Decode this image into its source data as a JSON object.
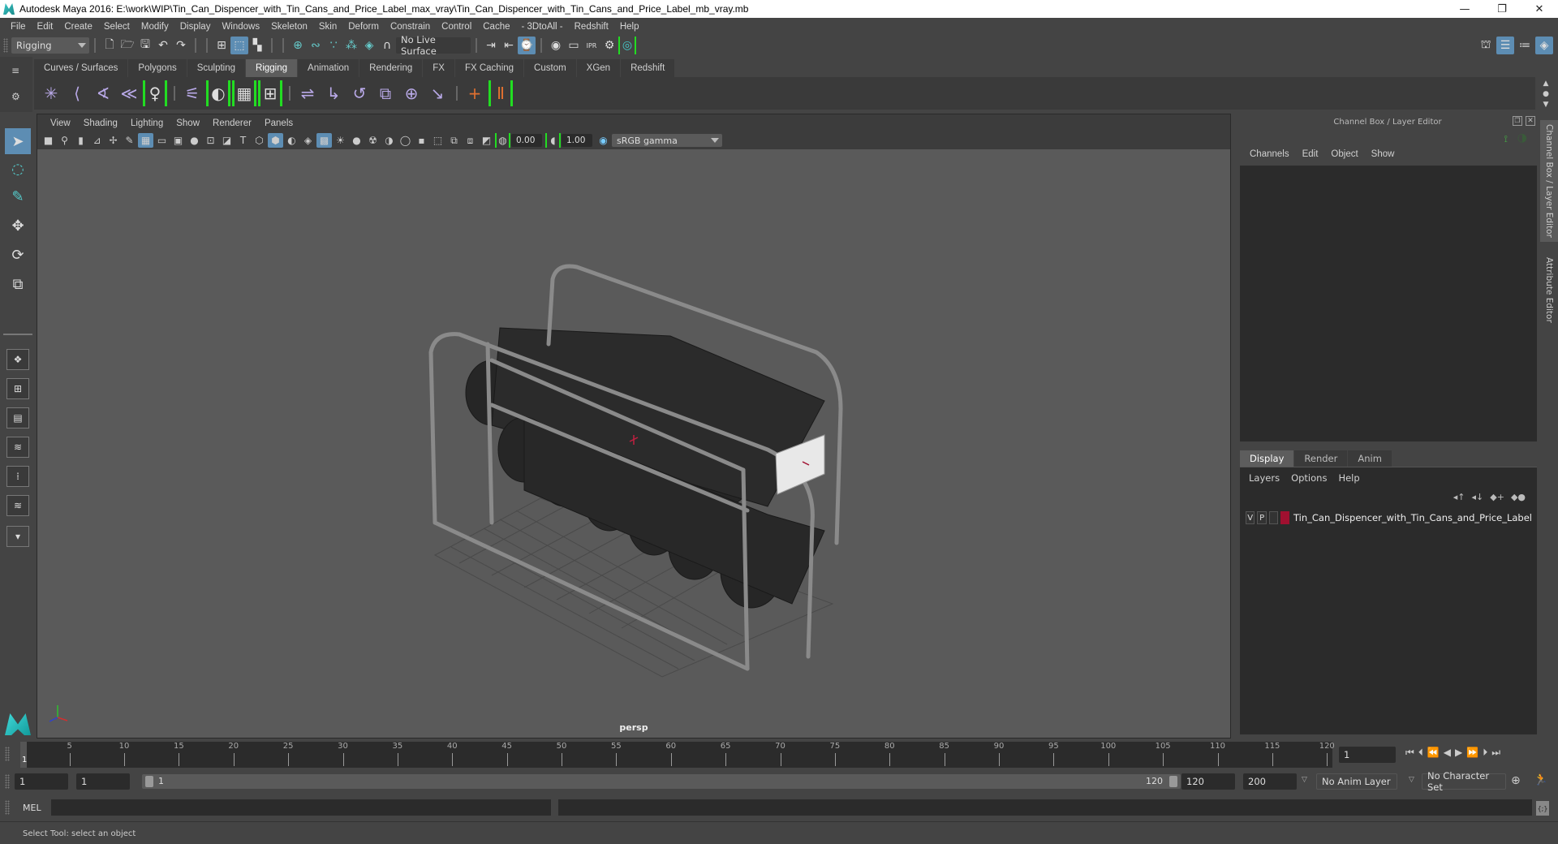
{
  "window": {
    "title": "Autodesk Maya 2016: E:\\work\\WIP\\Tin_Can_Dispencer_with_Tin_Cans_and_Price_Label_max_vray\\Tin_Can_Dispencer_with_Tin_Cans_and_Price_Label_mb_vray.mb",
    "controls": {
      "minimize": "—",
      "restore": "❐",
      "close": "✕"
    }
  },
  "menubar": [
    "File",
    "Edit",
    "Create",
    "Select",
    "Modify",
    "Display",
    "Windows",
    "Skeleton",
    "Skin",
    "Deform",
    "Constrain",
    "Control",
    "Cache",
    "- 3DtoAll -",
    "Redshift",
    "Help"
  ],
  "statusline": {
    "menuset": "Rigging",
    "live_surface": "No Live Surface",
    "icons": [
      "new-scene-icon",
      "open-scene-icon",
      "save-scene-icon",
      "undo-icon",
      "redo-icon",
      "select-hierarchy-icon",
      "select-object-icon",
      "select-component-icon",
      "snap-grid-icon",
      "snap-curve-icon",
      "snap-point-icon",
      "snap-view-plane-icon",
      "snap-surface-icon",
      "make-live-icon",
      "input-ops-icon",
      "output-ops-icon",
      "construction-history-icon",
      "render-view-icon",
      "render-current-icon",
      "ipr-render-icon",
      "render-settings-icon",
      "hypershade-icon"
    ],
    "right_icons": [
      "modeling-toolkit-icon",
      "channel-box-toggle-icon",
      "attribute-editor-toggle-icon",
      "layer-editor-toggle-icon"
    ]
  },
  "shelf": {
    "tabs": [
      "Curves / Surfaces",
      "Polygons",
      "Sculpting",
      "Rigging",
      "Animation",
      "Rendering",
      "FX",
      "FX Caching",
      "Custom",
      "XGen",
      "Redshift"
    ],
    "active_tab": "Rigging",
    "icons": [
      {
        "name": "joint-tool-icon",
        "glyph": "✳"
      },
      {
        "name": "insert-joint-icon",
        "glyph": "⟨"
      },
      {
        "name": "ik-handle-icon",
        "glyph": "∢"
      },
      {
        "name": "ik-spline-icon",
        "glyph": "≪"
      },
      {
        "name": "quick-rig-icon",
        "glyph": "♀"
      },
      {
        "name": "bind-skin-icon",
        "glyph": "⚟"
      },
      {
        "name": "paint-weights-icon",
        "glyph": "◐"
      },
      {
        "name": "lattice-icon",
        "glyph": "▦"
      },
      {
        "name": "cluster-icon",
        "glyph": "⊞"
      },
      {
        "name": "parent-constraint-icon",
        "glyph": "⇌"
      },
      {
        "name": "point-constraint-icon",
        "glyph": "↳"
      },
      {
        "name": "orient-constraint-icon",
        "glyph": "↺"
      },
      {
        "name": "scale-constraint-icon",
        "glyph": "⧉"
      },
      {
        "name": "aim-constraint-icon",
        "glyph": "⊕"
      },
      {
        "name": "pole-vector-constraint-icon",
        "glyph": "↘"
      },
      {
        "name": "locator-icon",
        "glyph": "+"
      },
      {
        "name": "hik-character-icon",
        "glyph": "Ⅱ"
      }
    ]
  },
  "toolbox": {
    "tools": [
      "select-tool-icon",
      "lasso-tool-icon",
      "paint-select-tool-icon",
      "move-tool-icon",
      "rotate-tool-icon",
      "scale-tool-icon"
    ],
    "layouts": [
      "single-perspective-layout-icon",
      "four-view-layout-icon",
      "persp-outliner-layout-icon",
      "persp-graph-layout-icon",
      "hypershade-persp-layout-icon",
      "persp-graph-hypershade-layout-icon",
      "more-layouts-icon"
    ]
  },
  "viewport": {
    "menu": [
      "View",
      "Shading",
      "Lighting",
      "Show",
      "Renderer",
      "Panels"
    ],
    "exposure": "0.00",
    "gamma": "1.00",
    "color_space": "sRGB gamma",
    "camera_label": "persp",
    "scene_object": "Tin_Can_Dispencer_with_Tin_Cans_and_Price_Label"
  },
  "channel_box": {
    "header": "Channel Box / Layer Editor",
    "menu": [
      "Channels",
      "Edit",
      "Object",
      "Show"
    ]
  },
  "layer_editor": {
    "tabs": [
      "Display",
      "Render",
      "Anim"
    ],
    "active_tab": "Display",
    "menu": [
      "Layers",
      "Options",
      "Help"
    ],
    "layers": [
      {
        "visible": "V",
        "playback": "P",
        "color": "#a01030",
        "name": "Tin_Can_Dispencer_with_Tin_Cans_and_Price_Label"
      }
    ]
  },
  "side_tabs": [
    "Channel Box / Layer Editor",
    "Attribute Editor"
  ],
  "timeline": {
    "ticks": [
      5,
      10,
      15,
      20,
      25,
      30,
      35,
      40,
      45,
      50,
      55,
      60,
      65,
      70,
      75,
      80,
      85,
      90,
      95,
      100,
      105,
      110,
      115,
      120
    ],
    "current_frame_marker": "1",
    "current_frame": "1",
    "range_min": 1,
    "range_max": 120
  },
  "range": {
    "start_time": "1",
    "playback_start": "1",
    "slider_start": "1",
    "slider_end": "120",
    "playback_end": "120",
    "end_time": "200",
    "anim_layer": "No Anim Layer",
    "character_set": "No Character Set"
  },
  "command_line": {
    "label": "MEL"
  },
  "help_line": "Select Tool: select an object"
}
